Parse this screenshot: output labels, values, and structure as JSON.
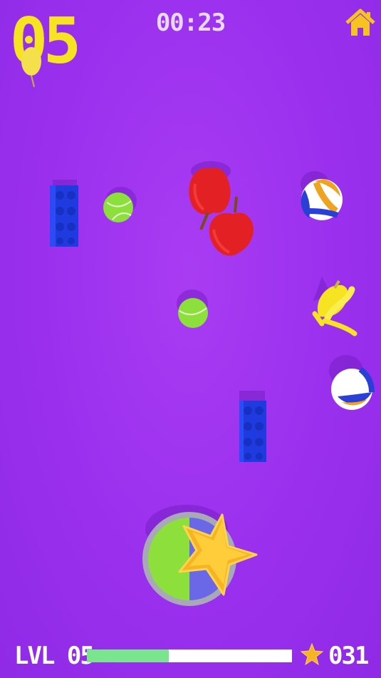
{
  "hud": {
    "countdown": "05",
    "timer": "00:23",
    "home_icon": "home-icon"
  },
  "footer": {
    "level_label": "LVL 05",
    "progress": 0.4,
    "star_count": "031",
    "star_icon": "star-icon"
  },
  "colors": {
    "background": "#9a30ee",
    "accent_yellow": "#f6e321",
    "progress_green": "#79e58d",
    "lego_blue": "#1f3be0",
    "tennis_green": "#8de03c",
    "apple_red": "#e32125",
    "ball_orange": "#f0a320"
  },
  "objects": [
    {
      "type": "lego-brick",
      "name": "lego-brick-left"
    },
    {
      "type": "tennis-ball",
      "name": "tennis-ball-top"
    },
    {
      "type": "apple",
      "name": "apple-top"
    },
    {
      "type": "apple",
      "name": "apple-middle"
    },
    {
      "type": "volleyball",
      "name": "volleyball-top"
    },
    {
      "type": "banana-bunch",
      "name": "banana-bunch"
    },
    {
      "type": "tennis-ball",
      "name": "tennis-ball-middle"
    },
    {
      "type": "volleyball",
      "name": "volleyball-bottom"
    },
    {
      "type": "lego-brick",
      "name": "lego-brick-right"
    },
    {
      "type": "star",
      "name": "star-collectible"
    },
    {
      "type": "target-hole",
      "name": "target-hole"
    }
  ]
}
